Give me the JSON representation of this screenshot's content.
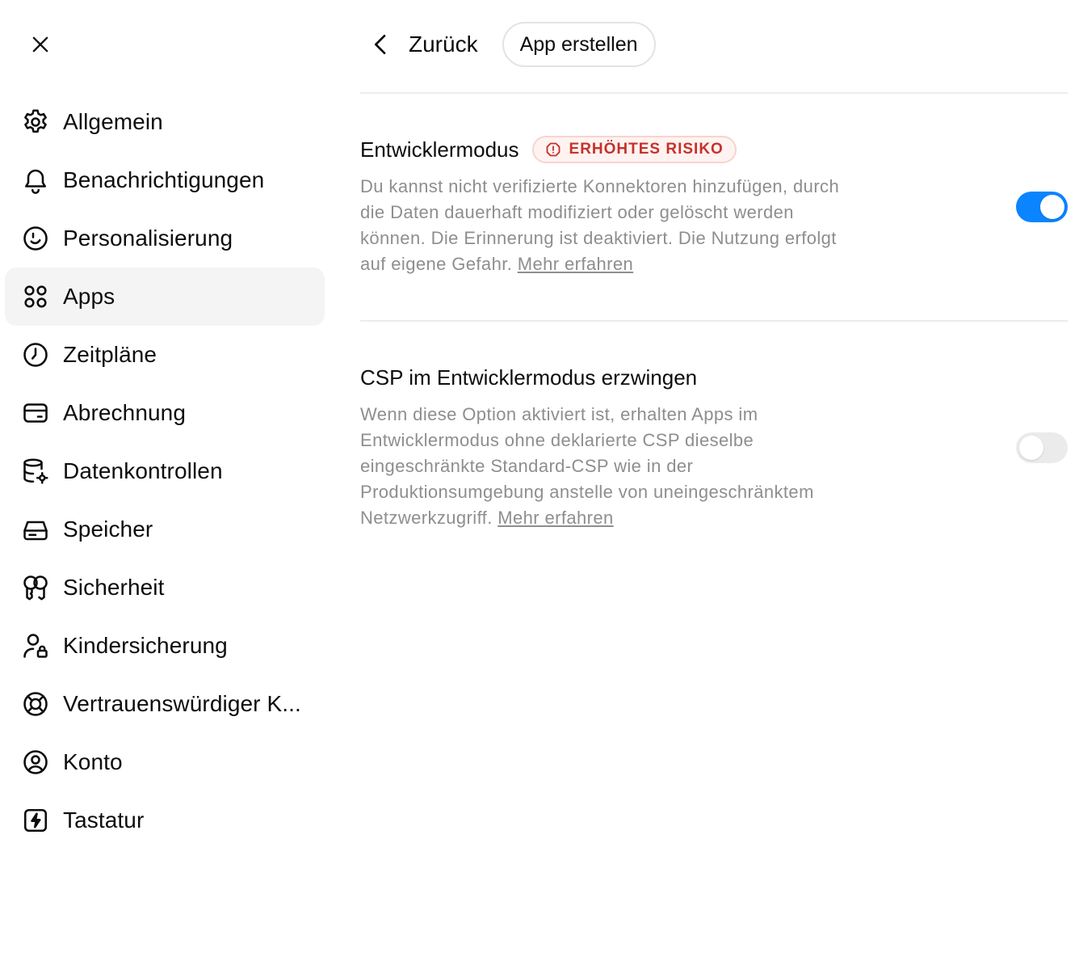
{
  "sidebar": {
    "items": [
      {
        "label": "Allgemein",
        "icon": "gear-icon"
      },
      {
        "label": "Benachrichtigungen",
        "icon": "bell-icon"
      },
      {
        "label": "Personalisierung",
        "icon": "smile-icon"
      },
      {
        "label": "Apps",
        "icon": "apps-grid-icon",
        "active": true
      },
      {
        "label": "Zeitpläne",
        "icon": "clock-icon"
      },
      {
        "label": "Abrechnung",
        "icon": "credit-card-icon"
      },
      {
        "label": "Datenkontrollen",
        "icon": "database-gear-icon"
      },
      {
        "label": "Speicher",
        "icon": "storage-drive-icon"
      },
      {
        "label": "Sicherheit",
        "icon": "security-key-icon"
      },
      {
        "label": "Kindersicherung",
        "icon": "person-lock-icon"
      },
      {
        "label": "Vertrauenswürdiger K...",
        "icon": "lifebuoy-icon"
      },
      {
        "label": "Konto",
        "icon": "account-circle-icon"
      },
      {
        "label": "Tastatur",
        "icon": "keyboard-bolt-icon"
      }
    ]
  },
  "header": {
    "back_label": "Zurück",
    "create_app_label": "App erstellen"
  },
  "settings": {
    "developer_mode": {
      "title": "Entwicklermodus",
      "badge": "ERHÖHTES RISIKO",
      "description": "Du kannst nicht verifizierte Konnektoren hinzufügen, durch die Daten dauerhaft modifiziert oder gelöscht werden können. Die Erinnerung ist deaktiviert. Die Nutzung erfolgt auf eigene Gefahr.",
      "link": "Mehr erfahren",
      "enabled": true
    },
    "csp": {
      "title": "CSP im Entwicklermodus erzwingen",
      "description": "Wenn diese Option aktiviert ist, erhalten Apps im Entwicklermodus ohne deklarierte CSP dieselbe eingeschränkte Standard-CSP wie in der Produktionsumgebung anstelle von uneingeschränktem Netzwerkzugriff.",
      "link": "Mehr erfahren",
      "enabled": false
    }
  },
  "colors": {
    "accent": "#0a84ff",
    "risk": "#c6312a",
    "muted_text": "#8e8e8e"
  }
}
